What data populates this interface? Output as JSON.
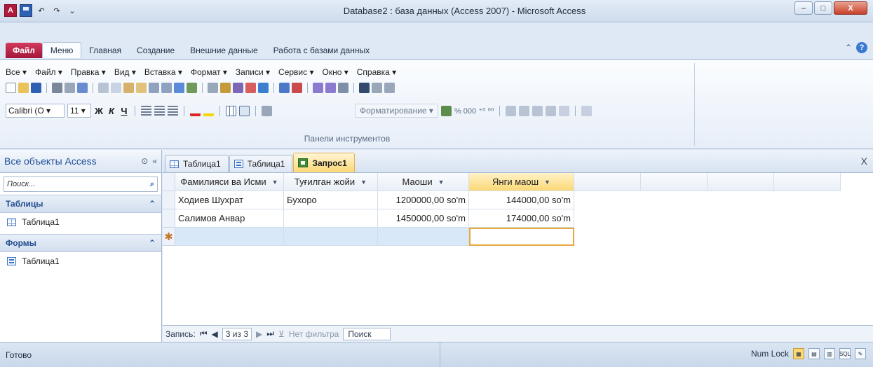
{
  "window": {
    "title": "Database2 : база данных (Access 2007)  -  Microsoft Access",
    "logo": "A",
    "minimize": "–",
    "maximize": "□",
    "close": "X"
  },
  "ribbon_tabs": [
    "Файл",
    "Меню",
    "Главная",
    "Создание",
    "Внешние данные",
    "Работа с базами данных"
  ],
  "help": {
    "collapse": "⌃",
    "question": "?"
  },
  "menu": {
    "items": [
      "Все ▾",
      "Файл ▾",
      "Правка ▾",
      "Вид ▾",
      "Вставка ▾",
      "Формат ▾",
      "Записи ▾",
      "Сервис ▾",
      "Окно ▾",
      "Справка ▾"
    ]
  },
  "toolbar": {
    "font_name": "Calibri (О ▾",
    "font_size": "11 ▾",
    "bold": "Ж",
    "italic": "К",
    "underline": "Ч",
    "formatting_label": "Форматирование ▾",
    "numbers_text": "% 000 ⁺⁰ ⁰⁰",
    "group_label": "Панели инструментов"
  },
  "nav": {
    "header": "Все объекты Access",
    "search_placeholder": "Поиск...",
    "groups": [
      {
        "title": "Таблицы",
        "items": [
          "Таблица1"
        ]
      },
      {
        "title": "Формы",
        "items": [
          "Таблица1"
        ]
      }
    ]
  },
  "doc_tabs": [
    {
      "label": "Таблица1",
      "icon": "table-icon"
    },
    {
      "label": "Таблица1",
      "icon": "form-icon"
    },
    {
      "label": "Запрос1",
      "icon": "query-icon"
    }
  ],
  "grid": {
    "columns": [
      "Фамилияси ва Исми",
      "Туғилган жойи",
      "Маоши",
      "Янги маош"
    ],
    "rows": [
      [
        "Ходиев Шухрат",
        "Бухоро",
        "1200000,00 so'm",
        "144000,00 so'm"
      ],
      [
        "Салимов Анвар",
        "",
        "1450000,00 so'm",
        "174000,00 so'm"
      ]
    ],
    "new_row_marker": "✱"
  },
  "record_nav": {
    "label": "Запись:",
    "first": "⏮",
    "prev": "◀",
    "current": "3 из 3",
    "next": "▶",
    "last": "⏭",
    "filter": "Нет фильтра",
    "search": "Поиск"
  },
  "status": {
    "left": "Готово",
    "numlock": "Num Lock"
  },
  "colors": {
    "accent": "#fcd876",
    "file_tab": "#b0193b",
    "nav_heading": "#1e4e96"
  }
}
